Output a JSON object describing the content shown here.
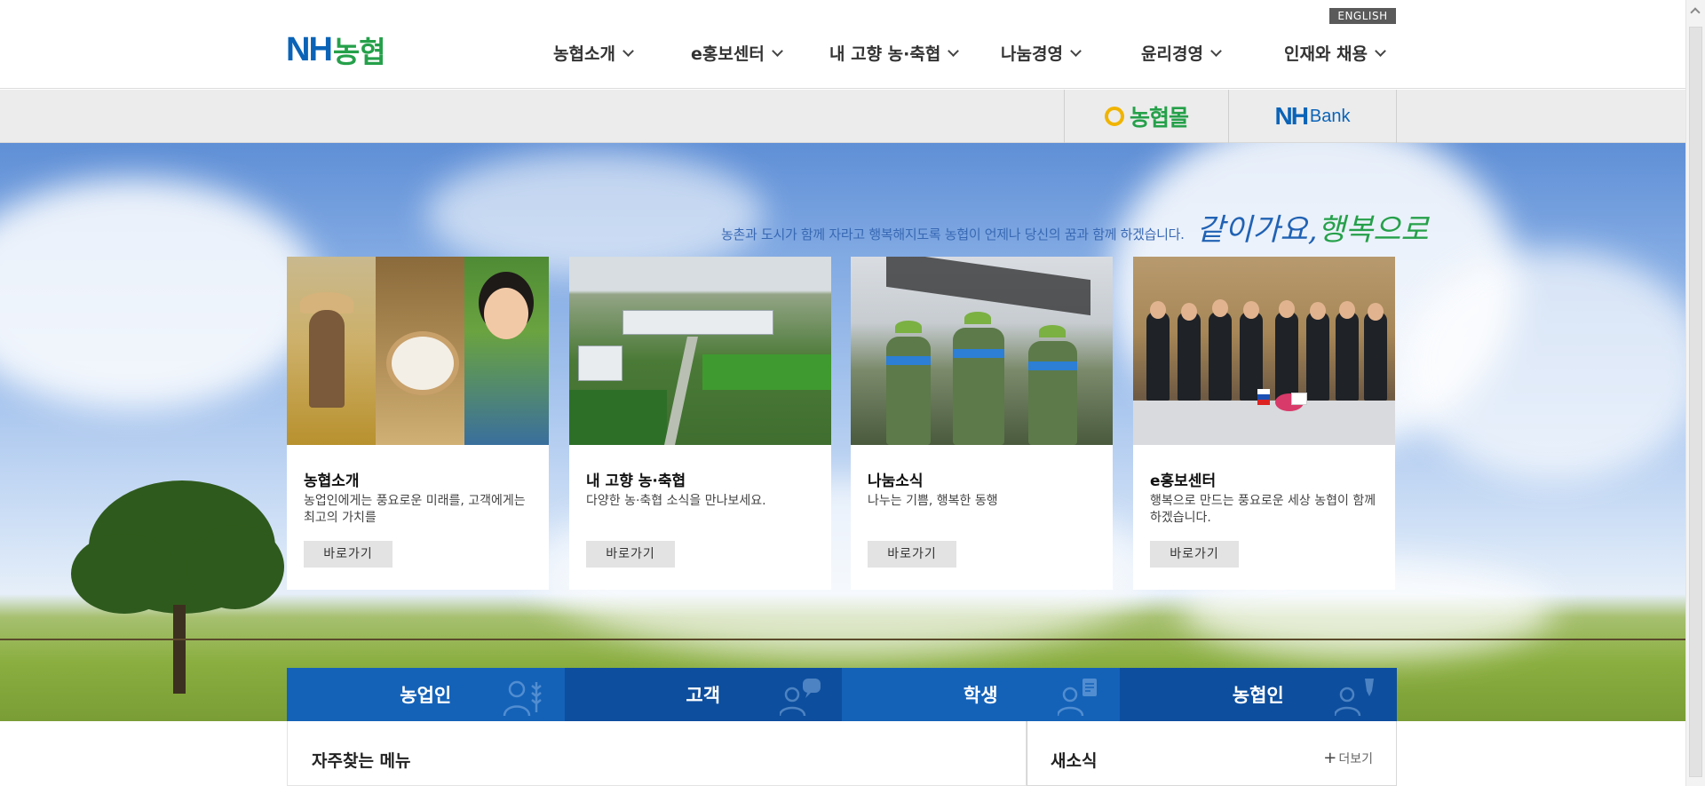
{
  "header": {
    "english_label": "ENGLISH",
    "logo": {
      "nh": "NH",
      "kr": "농협"
    },
    "nav": [
      {
        "label": "농협소개"
      },
      {
        "label": "e홍보센터"
      },
      {
        "label": "내 고향 농·축협"
      },
      {
        "label": "나눔경영"
      },
      {
        "label": "윤리경영"
      },
      {
        "label": "인재와 채용"
      }
    ]
  },
  "subbar": {
    "mall_label": "농협몰",
    "bank_nh": "NH",
    "bank_label": "Bank"
  },
  "hero": {
    "slogan": "농촌과 도시가 함께 자라고 행복해지도록 농협이 언제나 당신의 꿈과 함께 하겠습니다.",
    "script_part1": "같이가요,",
    "script_part2": "행복으로"
  },
  "cards": [
    {
      "title": "농협소개",
      "desc": "농업인에게는 풍요로운 미래를, 고객에게는 최고의 가치를",
      "button": "바로가기",
      "image": "farmer-rice-child"
    },
    {
      "title": "내 고향 농·축협",
      "desc": "다양한 농·축협 소식을 만나보세요.",
      "button": "바로가기",
      "image": "facility-aerial"
    },
    {
      "title": "나눔소식",
      "desc": "나누는 기쁨, 행복한 동행",
      "button": "바로가기",
      "image": "volunteers"
    },
    {
      "title": "e홍보센터",
      "desc": "행복으로 만드는 풍요로운 세상 농협이 함께 하겠습니다.",
      "button": "바로가기",
      "image": "meeting"
    }
  ],
  "tabs": [
    {
      "label": "농업인",
      "color": "#1462b8",
      "icon": "farmer-wheat-icon"
    },
    {
      "label": "고객",
      "color": "#0d4e9e",
      "icon": "customer-chat-icon"
    },
    {
      "label": "학생",
      "color": "#1462b8",
      "icon": "student-book-icon"
    },
    {
      "label": "농협인",
      "color": "#0d4e9e",
      "icon": "staff-badge-icon"
    }
  ],
  "bottom": {
    "faq_title": "자주찾는 메뉴",
    "news_title": "새소식",
    "more_label": "더보기"
  },
  "colors": {
    "brand_blue": "#0a63b7",
    "brand_green": "#25a04a",
    "tab_blue": "#1462b8",
    "tab_navy": "#0d4e9e"
  }
}
